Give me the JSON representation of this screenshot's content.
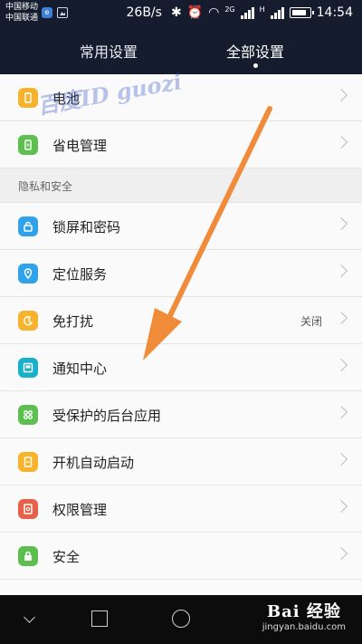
{
  "status_bar": {
    "carrier1": "中国移动",
    "carrier2": "中国联通",
    "net_speed": "26B/s",
    "signal_type": "2G",
    "signal_type2": "H",
    "time": "14:54"
  },
  "tabs": {
    "common": "常用设置",
    "all": "全部设置"
  },
  "list": {
    "section_privacy": "隐私和安全",
    "items": [
      {
        "label": "电池",
        "icon": "battery-icon",
        "color": "#f7b32b"
      },
      {
        "label": "省电管理",
        "icon": "power-saving-icon",
        "color": "#5cbf4f"
      },
      {
        "label": "锁屏和密码",
        "icon": "lock-screen-icon",
        "color": "#2fa2ea"
      },
      {
        "label": "定位服务",
        "icon": "location-icon",
        "color": "#2fa2ea"
      },
      {
        "label": "免打扰",
        "icon": "moon-icon",
        "color": "#f7b32b",
        "value": "关闭"
      },
      {
        "label": "通知中心",
        "icon": "notification-center-icon",
        "color": "#17b1c9"
      },
      {
        "label": "受保护的后台应用",
        "icon": "protected-apps-icon",
        "color": "#5cbf4f"
      },
      {
        "label": "开机自动启动",
        "icon": "autostart-icon",
        "color": "#f7b32b"
      },
      {
        "label": "权限管理",
        "icon": "permission-icon",
        "color": "#e8604a"
      },
      {
        "label": "安全",
        "icon": "security-lock-icon",
        "color": "#5cbf4f"
      }
    ]
  },
  "watermark_top": "百度ID guozi",
  "brand": {
    "line1": "Bai 经验",
    "line2": "jingyan.baidu.com"
  },
  "colors": {
    "header_bg": "#141c2e",
    "arrow": "#f08b3a"
  }
}
